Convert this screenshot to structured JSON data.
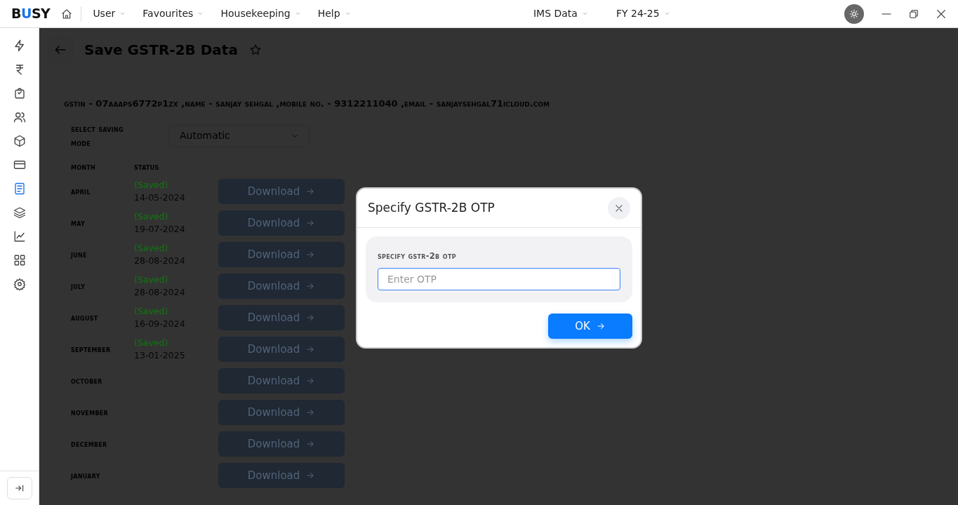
{
  "topbar": {
    "logo": "BUSY",
    "menus": [
      {
        "label": "User"
      },
      {
        "label": "Favourites"
      },
      {
        "label": "Housekeeping"
      },
      {
        "label": "Help"
      }
    ],
    "company": "IMS Data",
    "year": "FY 24-25"
  },
  "sidebar": {
    "items": [
      {
        "selected": false
      },
      {
        "selected": false
      },
      {
        "selected": false
      },
      {
        "selected": false
      },
      {
        "selected": false
      },
      {
        "selected": false
      },
      {
        "selected": true
      },
      {
        "selected": false
      },
      {
        "selected": false
      },
      {
        "selected": false
      },
      {
        "selected": false
      }
    ]
  },
  "page": {
    "title": "Save GSTR-2B Data",
    "info": "gstin - 07aaaps6772p1zx ,name - sanjay sehgal ,mobile no. - 9312211040 ,email - sanjaysehgal71icloud.com",
    "mode_label": "select saving mode",
    "mode_value": "Automatic",
    "columns": [
      "month",
      "status"
    ],
    "months": [
      {
        "month": "april",
        "status": "(Saved)",
        "date": "14-05-2024",
        "button": "Download"
      },
      {
        "month": "may",
        "status": "(Saved)",
        "date": "19-07-2024",
        "button": "Download"
      },
      {
        "month": "june",
        "status": "(Saved)",
        "date": "28-08-2024",
        "button": "Download"
      },
      {
        "month": "july",
        "status": "(Saved)",
        "date": "28-08-2024",
        "button": "Download"
      },
      {
        "month": "august",
        "status": "(Saved)",
        "date": "16-09-2024",
        "button": "Download"
      },
      {
        "month": "september",
        "status": "(Saved)",
        "date": "13-01-2025",
        "button": "Download"
      },
      {
        "month": "october",
        "button": "Download"
      },
      {
        "month": "november",
        "button": "Download"
      },
      {
        "month": "december",
        "button": "Download"
      },
      {
        "month": "january",
        "button": "Download"
      }
    ]
  },
  "dialog": {
    "title": "Specify GSTR-2B OTP",
    "label": "specify gstr-2b otp",
    "placeholder": "Enter OTP",
    "ok": "OK"
  }
}
